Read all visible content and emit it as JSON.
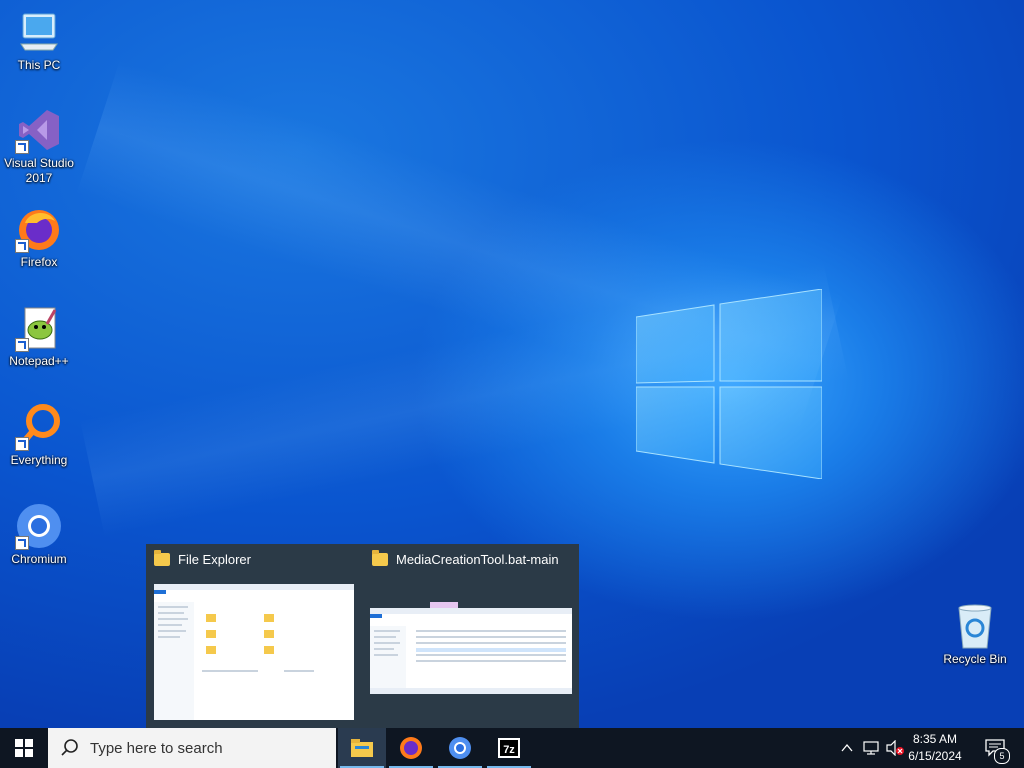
{
  "desktop": {
    "icons": [
      {
        "label": "This PC"
      },
      {
        "label": "Visual Studio 2017"
      },
      {
        "label": "Firefox"
      },
      {
        "label": "Notepad++"
      },
      {
        "label": "Everything"
      },
      {
        "label": "Chromium"
      },
      {
        "label": "Recycle Bin"
      }
    ]
  },
  "preview": {
    "windows": [
      {
        "title": "File Explorer"
      },
      {
        "title": "MediaCreationTool.bat-main"
      }
    ]
  },
  "taskbar": {
    "search_placeholder": "Type here to search",
    "apps": [
      "File Explorer",
      "Firefox",
      "Chromium",
      "7-Zip"
    ],
    "clock_time": "8:35 AM",
    "clock_date": "6/15/2024",
    "notification_count": "5"
  },
  "colors": {
    "taskbar": "#0e1622",
    "accent": "#76b9ed",
    "desktop": "#0a55cf"
  }
}
